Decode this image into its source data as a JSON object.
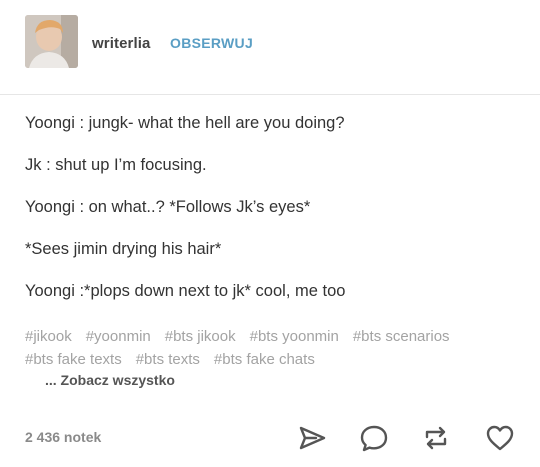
{
  "header": {
    "username": "writerlia",
    "follow_label": "OBSERWUJ"
  },
  "post": {
    "lines": [
      "Yoongi : jungk- what the hell are you doing?",
      "Jk : shut up I’m focusing.",
      "Yoongi : on what..? *Follows Jk’s eyes*",
      "*Sees jimin drying his hair*",
      "Yoongi :*plops down next to jk* cool, me too"
    ],
    "tags": [
      "#jikook",
      "#yoonmin",
      "#bts jikook",
      "#bts yoonmin",
      "#bts scenarios",
      "#bts fake texts",
      "#bts texts",
      "#bts fake chats"
    ],
    "see_all": "... Zobacz wszystko"
  },
  "footer": {
    "notes": "2 436 notek",
    "actions": [
      "share-icon",
      "reply-icon",
      "reblog-icon",
      "like-icon"
    ]
  },
  "colors": {
    "follow": "#5a9ec4",
    "tag": "#a3a3a3",
    "icon": "#555555"
  }
}
